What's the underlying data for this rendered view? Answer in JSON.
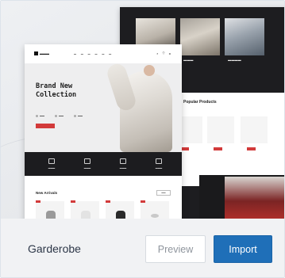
{
  "card": {
    "theme_name": "Garderobe",
    "preview_label": "Preview",
    "import_label": "Import"
  },
  "thumbnail": {
    "front_page": {
      "hero_title_line1": "Brand New",
      "hero_title_line2": "Collection",
      "new_arrivals_title": "New Arrivals"
    },
    "back_page": {
      "section_title": "Popular Products"
    }
  },
  "colors": {
    "import_button": "#1f6fb8",
    "accent_red": "#d23a3a",
    "dark_band": "#1c1c1f",
    "theme_name_text": "#2d3748"
  }
}
